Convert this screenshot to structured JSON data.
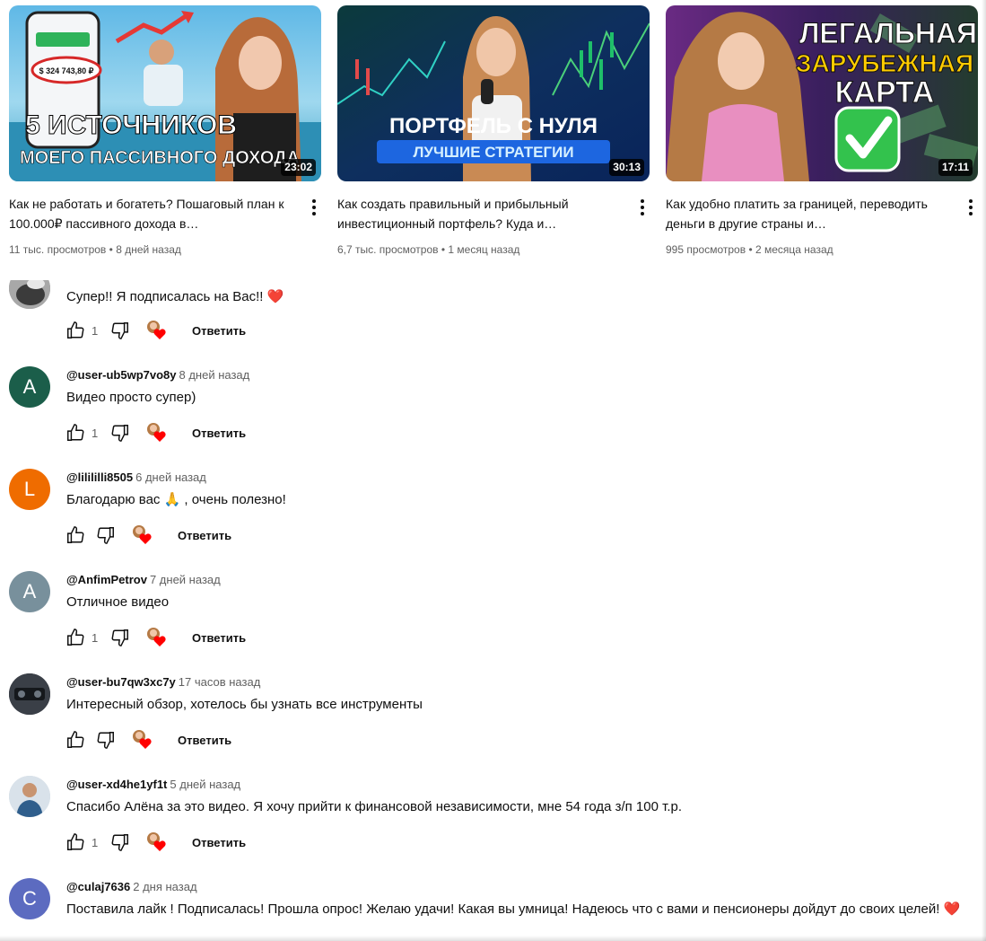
{
  "videos": [
    {
      "title": "Как не работать и богатеть? Пошаговый план к 100.000₽ пассивного дохода в…",
      "views": "11 тыс. просмотров",
      "age": "8 дней назад",
      "duration": "23:02",
      "thumb_text_1": "5 ИСТОЧНИКОВ",
      "thumb_text_2": "МОЕГО ПАССИВНОГО ДОХОДА",
      "thumb_balance": "$ 324 743,80 ₽"
    },
    {
      "title": "Как создать правильный и прибыльный инвестиционный портфель? Куда и…",
      "views": "6,7 тыс. просмотров",
      "age": "1 месяц назад",
      "duration": "30:13",
      "thumb_text_1": "ПОРТФЕЛЬ С НУЛЯ",
      "thumb_text_2": "ЛУЧШИЕ СТРАТЕГИИ"
    },
    {
      "title": "Как удобно платить за границей, переводить деньги в другие страны и…",
      "views": "995 просмотров",
      "age": "2 месяца назад",
      "duration": "17:11",
      "thumb_text_1": "ЛЕГАЛЬНАЯ",
      "thumb_text_2": "ЗАРУБЕЖНАЯ",
      "thumb_text_3": "КАРТА"
    }
  ],
  "meta_separator": "•",
  "reply_label": "Ответить",
  "comments": [
    {
      "author": "",
      "time": "",
      "text": "Супер!! Я подписалась на Вас!! ❤️",
      "likes": "1",
      "avatar_letter": "",
      "avatar_color": "#8a8a8a"
    },
    {
      "author": "@user-ub5wp7vo8y",
      "time": "8 дней назад",
      "text": "Видео просто супер)",
      "likes": "1",
      "avatar_letter": "A",
      "avatar_color": "#1b5e4a"
    },
    {
      "author": "@lilililli8505",
      "time": "6 дней назад",
      "text": "Благодарю вас 🙏 , очень полезно!",
      "likes": "",
      "avatar_letter": "L",
      "avatar_color": "#ef6c00"
    },
    {
      "author": "@AnfimPetrov",
      "time": "7 дней назад",
      "text": "Отличное видео",
      "likes": "1",
      "avatar_letter": "A",
      "avatar_color": "#78909c"
    },
    {
      "author": "@user-bu7qw3xc7y",
      "time": "17 часов назад",
      "text": "Интересный обзор, хотелось бы узнать все инструменты",
      "likes": "",
      "avatar_letter": "",
      "avatar_color": "#2b2f36"
    },
    {
      "author": "@user-xd4he1yf1t",
      "time": "5 дней назад",
      "text": "Спасибо Алёна за это видео. Я хочу прийти к финансовой независимости, мне 54 года з/п 100 т.р.",
      "likes": "1",
      "avatar_letter": "",
      "avatar_color": "#c9d3dc"
    },
    {
      "author": "@culaj7636",
      "time": "2 дня назад",
      "text": "Поставила лайк ! Подписалась! Прошла опрос! Желаю удачи! Какая вы умница! Надеюсь что с вами и пенсионеры дойдут до своих целей! ❤️",
      "likes": "",
      "avatar_letter": "C",
      "avatar_color": "#5c6bc0"
    }
  ]
}
